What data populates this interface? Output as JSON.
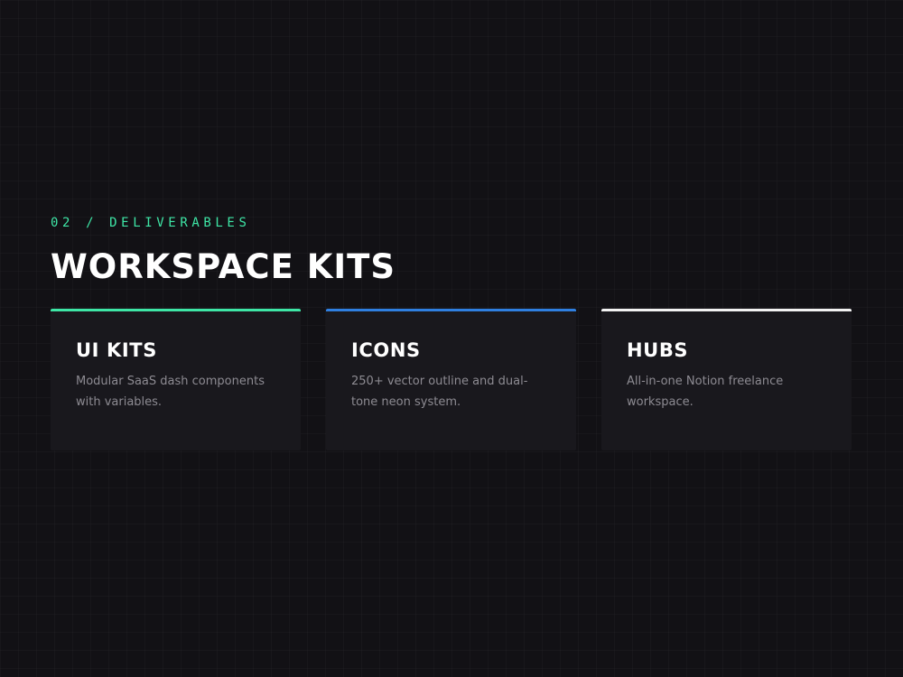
{
  "section": {
    "eyebrow": "02 / DELIVERABLES",
    "title": "WORKSPACE KITS"
  },
  "accent_colors": {
    "green": "#3ee6a6",
    "blue": "#2f7fe0",
    "white": "#f2f2f2"
  },
  "cards": [
    {
      "title": "UI KITS",
      "description": "Modular SaaS dash components with variables.",
      "accent": "#3ee6a6"
    },
    {
      "title": "ICONS",
      "description": "250+ vector outline and dual-tone neon system.",
      "accent": "#2f7fe0"
    },
    {
      "title": "HUBS",
      "description": "All-in-one Notion freelance workspace.",
      "accent": "#f2f2f2"
    }
  ]
}
